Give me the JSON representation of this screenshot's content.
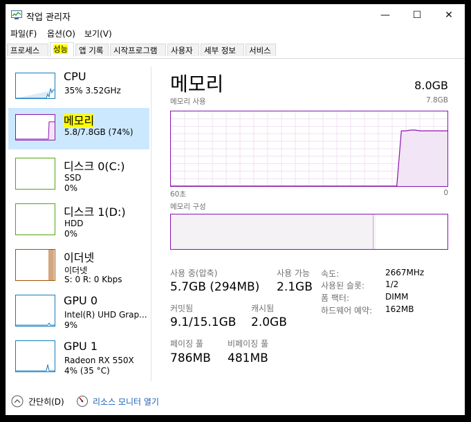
{
  "window": {
    "title": "작업 관리자",
    "controls": {
      "minimize": "—",
      "maximize": "☐",
      "close": "✕"
    }
  },
  "menu": [
    "파일(F)",
    "옵션(O)",
    "보기(V)"
  ],
  "tabs": [
    {
      "label": "프로세스"
    },
    {
      "label": "성능",
      "active": true
    },
    {
      "label": "앱 기록"
    },
    {
      "label": "시작프로그램"
    },
    {
      "label": "사용자"
    },
    {
      "label": "세부 정보"
    },
    {
      "label": "서비스"
    }
  ],
  "sidebar": {
    "cpu": {
      "name": "CPU",
      "line2": "35%  3.52GHz",
      "color": "#117dbb"
    },
    "memory": {
      "name": "메모리",
      "line2": "5.8/7.8GB (74%)",
      "color": "#8b12ae"
    },
    "disk0": {
      "name": "디스크 0(C:)",
      "line2": "SSD",
      "line3": "0%",
      "color": "#4da60c"
    },
    "disk1": {
      "name": "디스크 1(D:)",
      "line2": "HDD",
      "line3": "0%",
      "color": "#4da60c"
    },
    "ethernet": {
      "name": "이더넷",
      "line2": "이더넷",
      "line3": "S: 0  R: 0 Kbps",
      "color": "#a74f01"
    },
    "gpu0": {
      "name": "GPU 0",
      "line2": "Intel(R) UHD Grap...",
      "line3": "9%",
      "color": "#117dbb"
    },
    "gpu1": {
      "name": "GPU 1",
      "line2": "Radeon RX 550X",
      "line3": "4% (35 °C)",
      "color": "#117dbb"
    }
  },
  "main": {
    "title": "메모리",
    "total": "8.0GB",
    "usage_label": "메모리 사용",
    "usage_max": "7.8GB",
    "x_left": "60초",
    "x_right": "0",
    "composition_label": "메모리 구성",
    "accent": "#8b12ae",
    "usage_history_fraction": [
      0,
      0,
      0,
      0,
      0,
      0,
      0,
      0,
      0,
      0,
      0,
      0,
      0,
      0,
      0,
      0,
      0,
      0,
      0,
      0,
      0,
      0,
      0,
      0,
      0,
      0,
      0,
      0,
      0,
      0,
      0,
      0,
      0,
      0,
      0,
      0,
      0,
      0,
      0,
      0,
      0,
      0,
      0,
      0,
      0,
      0,
      0,
      0,
      0,
      0,
      0.74,
      0.74,
      0.75,
      0.75,
      0.74,
      0.74,
      0.74,
      0.74,
      0.74,
      0.74,
      0.74
    ],
    "stats": {
      "in_use": {
        "label": "사용 중(압축)",
        "value": "5.7GB (294MB)"
      },
      "available": {
        "label": "사용 가능",
        "value": "2.1GB"
      },
      "committed": {
        "label": "커밋됨",
        "value": "9.1/15.1GB"
      },
      "cached": {
        "label": "캐시됨",
        "value": "2.0GB"
      },
      "paged": {
        "label": "페이징 풀",
        "value": "786MB"
      },
      "nonpaged": {
        "label": "비페이징 풀",
        "value": "481MB"
      }
    },
    "specs": [
      {
        "label": "속도:",
        "value": "2667MHz"
      },
      {
        "label": "사용된 슬롯:",
        "value": "1/2"
      },
      {
        "label": "폼 팩터:",
        "value": "DIMM"
      },
      {
        "label": "하드웨어 예약:",
        "value": "162MB"
      }
    ]
  },
  "footer": {
    "collapse": "간단히(D)",
    "resource_monitor": "리소스 모니터 열기"
  }
}
